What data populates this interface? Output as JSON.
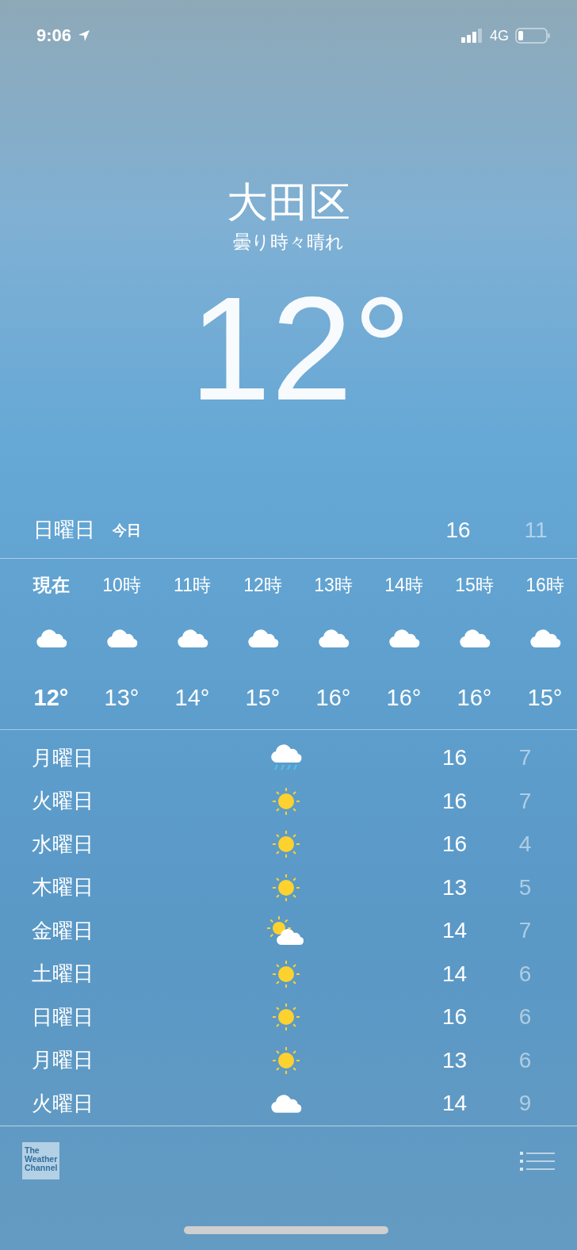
{
  "status_bar": {
    "time": "9:06",
    "network": "4G"
  },
  "location": {
    "city": "大田区",
    "condition": "曇り時々晴れ",
    "temperature": "12°"
  },
  "today": {
    "day": "日曜日",
    "label": "今日",
    "high": "16",
    "low": "11"
  },
  "hourly": [
    {
      "kind": "now",
      "time": "現在",
      "temp": "12°"
    },
    {
      "kind": "hour",
      "time": "10時",
      "temp": "13°"
    },
    {
      "kind": "hour",
      "time": "11時",
      "temp": "14°"
    },
    {
      "kind": "hour",
      "time": "12時",
      "temp": "15°"
    },
    {
      "kind": "hour",
      "time": "13時",
      "temp": "16°"
    },
    {
      "kind": "hour",
      "time": "14時",
      "temp": "16°"
    },
    {
      "kind": "hour",
      "time": "15時",
      "temp": "16°"
    },
    {
      "kind": "hour",
      "time": "16時",
      "temp": "15°"
    }
  ],
  "daily": [
    {
      "day": "月曜日",
      "kind": "rain",
      "high": "16",
      "low": "7"
    },
    {
      "day": "火曜日",
      "kind": "sun",
      "high": "16",
      "low": "7"
    },
    {
      "day": "水曜日",
      "kind": "sun",
      "high": "16",
      "low": "4"
    },
    {
      "day": "木曜日",
      "kind": "sun",
      "high": "13",
      "low": "5"
    },
    {
      "day": "金曜日",
      "kind": "partly",
      "high": "14",
      "low": "7"
    },
    {
      "day": "土曜日",
      "kind": "sun",
      "high": "14",
      "low": "6"
    },
    {
      "day": "日曜日",
      "kind": "sun",
      "high": "16",
      "low": "6"
    },
    {
      "day": "月曜日",
      "kind": "sun",
      "high": "13",
      "low": "6"
    },
    {
      "day": "火曜日",
      "kind": "cloud",
      "high": "14",
      "low": "9"
    }
  ],
  "footer": {
    "logo": [
      "The",
      "Weather",
      "Channel"
    ]
  }
}
